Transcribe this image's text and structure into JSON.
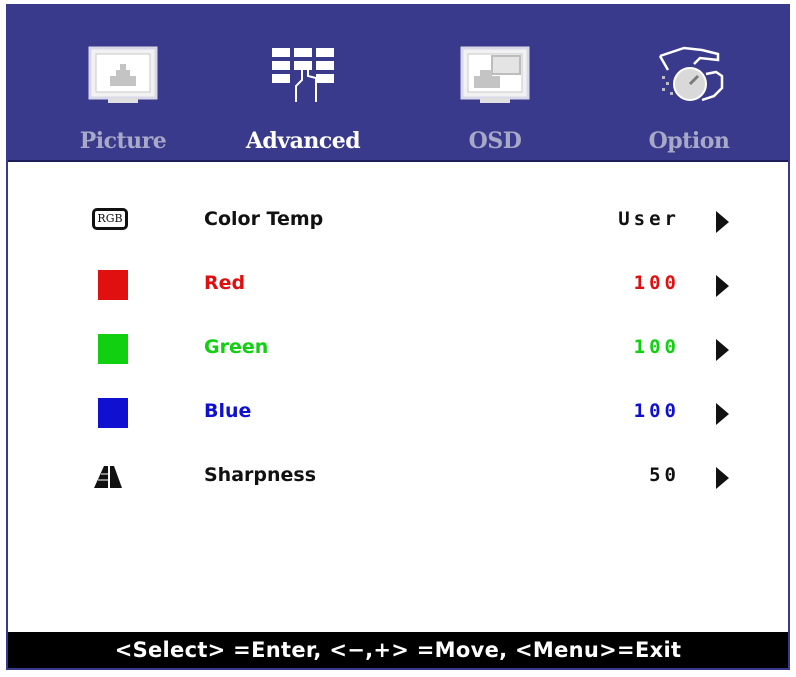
{
  "tabs": [
    {
      "label": "Picture",
      "icon": "picture-icon",
      "active": false
    },
    {
      "label": "Advanced",
      "icon": "advanced-icon",
      "active": true
    },
    {
      "label": "OSD",
      "icon": "osd-icon",
      "active": false
    },
    {
      "label": "Option",
      "icon": "option-icon",
      "active": false
    }
  ],
  "menu": {
    "color_temp": {
      "badge": "RGB",
      "label": "Color Temp",
      "value": "User",
      "color": "#111111"
    },
    "red": {
      "label": "Red",
      "value": "100",
      "color": "#e01010"
    },
    "green": {
      "label": "Green",
      "value": "100",
      "color": "#10d010"
    },
    "blue": {
      "label": "Blue",
      "value": "100",
      "color": "#1010d0"
    },
    "sharpness": {
      "label": "Sharpness",
      "value": "50",
      "color": "#111111"
    }
  },
  "status_bar": "<Select> =Enter, <−,+> =Move, <Menu>=Exit",
  "colors": {
    "tab_bar": "#3a3a8c",
    "tab_label_inactive": "#a8a8c8",
    "tab_label_active": "#ffffff"
  }
}
